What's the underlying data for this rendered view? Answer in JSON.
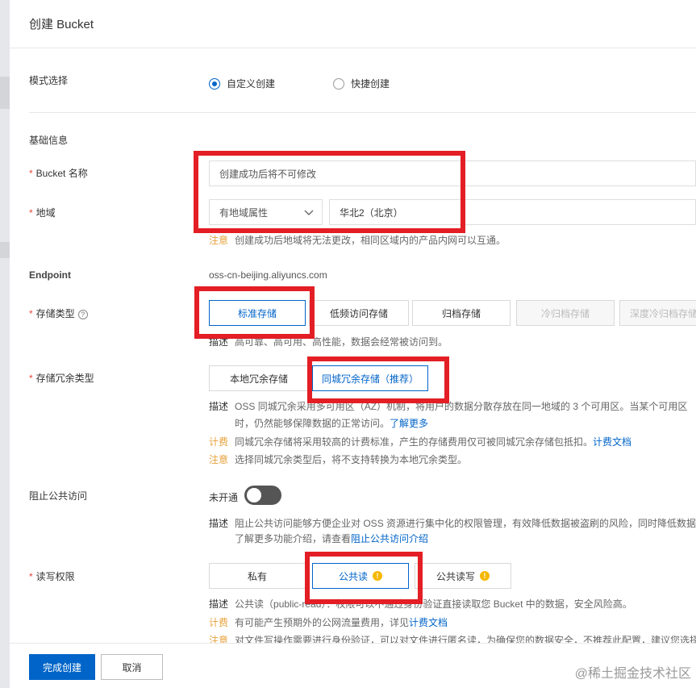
{
  "dialog": {
    "title": "创建 Bucket"
  },
  "mode": {
    "label": "模式选择",
    "options": [
      {
        "label": "自定义创建",
        "selected": true
      },
      {
        "label": "快捷创建",
        "selected": false
      }
    ]
  },
  "basic_section": "基础信息",
  "bucket_name": {
    "label": "Bucket 名称",
    "placeholder": "创建成功后将不可修改"
  },
  "region": {
    "label": "地域",
    "type_value": "有地域属性",
    "region_value": "华北2（北京）",
    "note_tag": "注意",
    "note_text": "创建成功后地域将无法更改，相同区域内的产品内网可以互通。"
  },
  "endpoint": {
    "label": "Endpoint",
    "value": "oss-cn-beijing.aliyuncs.com"
  },
  "storage_class": {
    "label": "存储类型",
    "options": [
      "标准存储",
      "低频访问存储",
      "归档存储",
      "冷归档存储",
      "深度冷归档存储"
    ],
    "desc_tag": "描述",
    "desc_text": "高可靠、高可用、高性能，数据会经常被访问到。"
  },
  "redundancy": {
    "label": "存储冗余类型",
    "options": [
      "本地冗余存储",
      "同城冗余存储（推荐）"
    ],
    "desc_tag": "描述",
    "desc_line1": "OSS 同城冗余采用多可用区（AZ）机制，将用户的数据分散存放在同一地域的 3 个可用区。当某个可用区",
    "desc_line2": "时，仍然能够保障数据的正常访问。",
    "desc_link": "了解更多",
    "fee_tag": "计费",
    "fee_text": "同城冗余存储将采用较高的计费标准，产生的存储费用仅可被同城冗余存储包抵扣。",
    "fee_link": "计费文档",
    "note_tag": "注意",
    "note_text": "选择同城冗余类型后，将不支持转换为本地冗余类型。"
  },
  "block_public": {
    "label": "阻止公共访问",
    "status": "未开通",
    "desc_tag": "描述",
    "desc_line1": "阻止公共访问能够方便企业对 OSS 资源进行集中化的权限管理，有效降低数据被盗刷的风险，同时降低数据泄",
    "desc_line2": "了解更多功能介绍，请查看",
    "desc_link": "阻止公共访问介绍"
  },
  "acl": {
    "label": "读写权限",
    "options": [
      "私有",
      "公共读",
      "公共读写"
    ],
    "desc_tag": "描述",
    "desc_text": "公共读（public-read）：权限可以不通过身份验证直接读取您 Bucket 中的数据，安全风险高。",
    "fee_tag": "计费",
    "fee_text": "有可能产生预期外的公网流量费用，详见",
    "fee_link": "计费文档",
    "note_tag": "注意",
    "note_text": "对文件写操作需要进行身份验证，可以对文件进行匿名读，为确保您的数据安全，不推荐此配置，建议您选择"
  },
  "footer": {
    "confirm": "完成创建",
    "cancel": "取消"
  },
  "watermark": "@稀土掘金技术社区",
  "colors": {
    "accent": "#0064c8",
    "annotation": "#e31e24",
    "warning": "#e6a23c"
  }
}
